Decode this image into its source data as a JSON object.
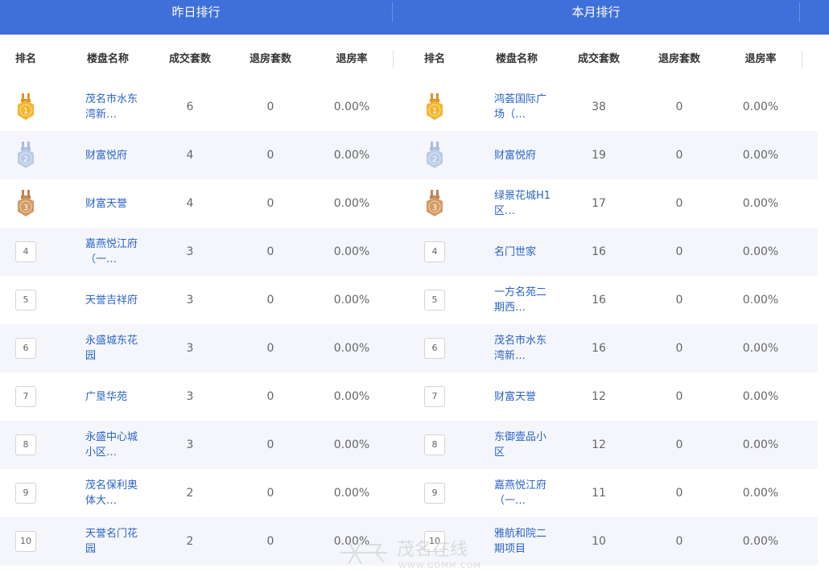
{
  "tabs": {
    "yesterday": "昨日排行",
    "month": "本月排行"
  },
  "columns": [
    "排名",
    "楼盘名称",
    "成交套数",
    "退房套数",
    "退房率"
  ],
  "colors": {
    "header_bg": "#3f6fd8",
    "link": "#2a63c7",
    "row_alt": "#f4f6fb",
    "medal_gold": "#f3b52a",
    "medal_silver": "#b9cbe6",
    "medal_bronze": "#d39a62"
  },
  "yesterday_rows": [
    {
      "rank": "1",
      "name": "茂名市水东湾新…",
      "deals": "6",
      "returns": "0",
      "rate": "0.00%"
    },
    {
      "rank": "2",
      "name": "财富悦府",
      "deals": "4",
      "returns": "0",
      "rate": "0.00%"
    },
    {
      "rank": "3",
      "name": "财富天誉",
      "deals": "4",
      "returns": "0",
      "rate": "0.00%"
    },
    {
      "rank": "4",
      "name": "嘉燕悦江府（一…",
      "deals": "3",
      "returns": "0",
      "rate": "0.00%"
    },
    {
      "rank": "5",
      "name": "天誉吉祥府",
      "deals": "3",
      "returns": "0",
      "rate": "0.00%"
    },
    {
      "rank": "6",
      "name": "永盛城东花园",
      "deals": "3",
      "returns": "0",
      "rate": "0.00%"
    },
    {
      "rank": "7",
      "name": "广垦华苑",
      "deals": "3",
      "returns": "0",
      "rate": "0.00%"
    },
    {
      "rank": "8",
      "name": "永盛中心城小区…",
      "deals": "3",
      "returns": "0",
      "rate": "0.00%"
    },
    {
      "rank": "9",
      "name": "茂名保利奥体大…",
      "deals": "2",
      "returns": "0",
      "rate": "0.00%"
    },
    {
      "rank": "10",
      "name": "天誉名门花园",
      "deals": "2",
      "returns": "0",
      "rate": "0.00%"
    }
  ],
  "month_rows": [
    {
      "rank": "1",
      "name": "鸿荟国际广场（…",
      "deals": "38",
      "returns": "0",
      "rate": "0.00%"
    },
    {
      "rank": "2",
      "name": "财富悦府",
      "deals": "19",
      "returns": "0",
      "rate": "0.00%"
    },
    {
      "rank": "3",
      "name": "绿景花城H1区…",
      "deals": "17",
      "returns": "0",
      "rate": "0.00%"
    },
    {
      "rank": "4",
      "name": "名门世家",
      "deals": "16",
      "returns": "0",
      "rate": "0.00%"
    },
    {
      "rank": "5",
      "name": "一方名苑二期西…",
      "deals": "16",
      "returns": "0",
      "rate": "0.00%"
    },
    {
      "rank": "6",
      "name": "茂名市水东湾新…",
      "deals": "16",
      "returns": "0",
      "rate": "0.00%"
    },
    {
      "rank": "7",
      "name": "财富天誉",
      "deals": "12",
      "returns": "0",
      "rate": "0.00%"
    },
    {
      "rank": "8",
      "name": "东御壹品小区",
      "deals": "12",
      "returns": "0",
      "rate": "0.00%"
    },
    {
      "rank": "9",
      "name": "嘉燕悦江府（一…",
      "deals": "11",
      "returns": "0",
      "rate": "0.00%"
    },
    {
      "rank": "10",
      "name": "雅航和院二期项目",
      "deals": "10",
      "returns": "0",
      "rate": "0.00%"
    }
  ],
  "watermark": {
    "cn": "茂名在线",
    "url": "WWW.GDMM.COM"
  }
}
